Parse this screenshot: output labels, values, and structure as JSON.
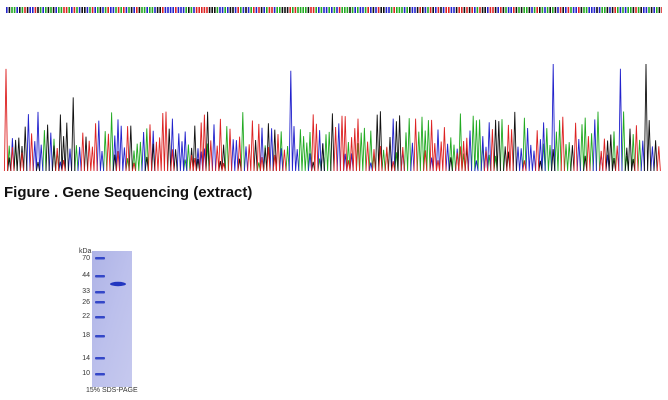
{
  "caption": "Figure . Gene Sequencing (extract)",
  "gel": {
    "unit_label": "kDa",
    "markers": [
      "70",
      "44",
      "33",
      "26",
      "22",
      "18",
      "14",
      "10"
    ],
    "caption": "15% SDS-PAGE"
  },
  "colors": {
    "base_A": "#22aa22",
    "base_C": "#2222cc",
    "base_G": "#111111",
    "base_T": "#dd2222",
    "gel_background": "#b9bde8",
    "gel_band": "#2a3fc6"
  }
}
